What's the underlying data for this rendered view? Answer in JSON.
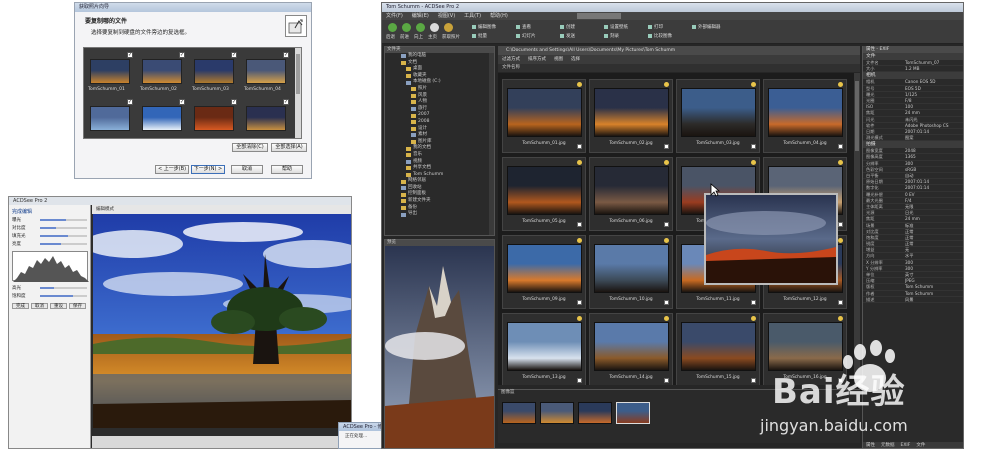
{
  "colors": {
    "main_bg": "#262626",
    "accent_blue": "#0d3a8a",
    "badge_gold": "#e8c44a",
    "dialog_bg": "#f4f4f6"
  },
  "import_dialog": {
    "title": "获取照片向导",
    "heading": "要复制哪的文件",
    "subheading": "选择要复制到硬盘的文件旁边的复选框。",
    "thumb_captions": [
      "TomSchumm_01",
      "TomSchumm_02",
      "TomSchumm_03",
      "TomSchumm_04"
    ],
    "buttons": {
      "deselect_all": "全部清除(C)",
      "select_all": "全部选择(A)",
      "back": "< 上一步(B)",
      "next": "下一步(N) >",
      "cancel": "取消",
      "help": "帮助"
    }
  },
  "editor": {
    "title": "ACDSee Pro 2",
    "side_tab": "完成编辑",
    "topbar_text": "编辑模式",
    "sliders": [
      {
        "label": "曝光",
        "value": 0.55
      },
      {
        "label": "对比度",
        "value": 0.35
      },
      {
        "label": "填充光",
        "value": 0.6
      },
      {
        "label": "亮度",
        "value": 0.45
      },
      {
        "label": "高光",
        "value": 0.3
      },
      {
        "label": "饱和度",
        "value": 0.7
      }
    ],
    "buttons": [
      "完成",
      "取消",
      "重设",
      "保存"
    ]
  },
  "small_dialog": {
    "title": "ACDSee Pro - 修改数据库",
    "left_text": "正在处理...",
    "right_text": "已完成"
  },
  "main": {
    "title": "Tom Schumm - ACDSee Pro 2",
    "menus": [
      "文件(F)",
      "编辑(E)",
      "视图(V)",
      "工具(T)",
      "帮助(H)"
    ],
    "nav_buttons": [
      {
        "label": "后退",
        "color": "#5aa843"
      },
      {
        "label": "前进",
        "color": "#5aa843"
      },
      {
        "label": "向上",
        "color": "#5aa843"
      },
      {
        "label": "主页",
        "color": "#d9d9d9"
      },
      {
        "label": "获取照片",
        "color": "#c9a23a"
      }
    ],
    "tool_items": [
      "编辑图像",
      "批量",
      "查看",
      "幻灯片",
      "创建",
      "发送",
      "设置壁纸",
      "刻录",
      "打印",
      "比较图像",
      "外部编辑器"
    ],
    "tree": {
      "header": "文件夹",
      "items": [
        "我的电脑",
        "文档",
        "桌面",
        "收藏夹",
        "本地磁盘 (C:)",
        "照片",
        "风景",
        "人物",
        "旅行",
        "2007",
        "2008",
        "设计",
        "素材",
        "图片库",
        "我的文档",
        "音乐",
        "视频",
        "共享文档",
        "Tom Schumm",
        "网络邻居",
        "回收站",
        "控制面板",
        "新建文件夹",
        "备份",
        "导出"
      ]
    },
    "preview_header": "预览",
    "folder_path": "C:\\Documents and Settings\\All Users\\Documents\\My Pictures\\Tom Schumm",
    "filter_bar": [
      "过滤方式",
      "排序方式",
      "视图",
      "选择"
    ],
    "sort_label": "文件名称",
    "thumbnails": [
      "TomSchumm_01.jpg",
      "TomSchumm_02.jpg",
      "TomSchumm_03.jpg",
      "TomSchumm_04.jpg",
      "TomSchumm_05.jpg",
      "TomSchumm_06.jpg",
      "TomSchumm_07.jpg",
      "TomSchumm_08.jpg",
      "TomSchumm_09.jpg",
      "TomSchumm_10.jpg",
      "TomSchumm_11.jpg",
      "TomSchumm_12.jpg",
      "TomSchumm_13.jpg",
      "TomSchumm_14.jpg",
      "TomSchumm_15.jpg",
      "TomSchumm_16.jpg"
    ],
    "strip_header": "图像篮",
    "props": {
      "header": "属性 - EXIF",
      "sections": [
        {
          "title": "文件",
          "rows": [
            [
              "文件名",
              "TomSchumm_07"
            ],
            [
              "大小",
              "1.2 MB"
            ]
          ]
        },
        {
          "title": "相机",
          "rows": [
            [
              "相机",
              "Canon EOS 5D"
            ],
            [
              "型号",
              "EOS 5D"
            ],
            [
              "曝光",
              "1/125"
            ],
            [
              "光圈",
              "F/8"
            ],
            [
              "ISO",
              "100"
            ],
            [
              "焦距",
              "24 mm"
            ],
            [
              "闪光",
              "未闪光"
            ],
            [
              "软件",
              "Adobe Photoshop CS"
            ],
            [
              "日期",
              "2007:01:14"
            ],
            [
              "测光模式",
              "图案"
            ]
          ]
        },
        {
          "title": "拍摄",
          "rows": [
            [
              "图像宽度",
              "2048"
            ],
            [
              "图像高度",
              "1365"
            ],
            [
              "分辨率",
              "300"
            ],
            [
              "色彩空间",
              "sRGB"
            ],
            [
              "白平衡",
              "自动"
            ],
            [
              "原始日期",
              "2007:01:14"
            ],
            [
              "数字化",
              "2007:01:14"
            ],
            [
              "曝光补偿",
              "0 EV"
            ],
            [
              "最大光圈",
              "F/4"
            ],
            [
              "主体距离",
              "无限"
            ],
            [
              "光源",
              "日光"
            ],
            [
              "焦距",
              "24 mm"
            ],
            [
              "场景",
              "标准"
            ],
            [
              "对比度",
              "正常"
            ],
            [
              "饱和度",
              "正常"
            ],
            [
              "锐度",
              "正常"
            ],
            [
              "增益",
              "无"
            ],
            [
              "方向",
              "水平"
            ],
            [
              "X 分辨率",
              "300"
            ],
            [
              "Y 分辨率",
              "300"
            ],
            [
              "单位",
              "英寸"
            ],
            [
              "压缩",
              "JPEG"
            ],
            [
              "版权",
              "Tom Schumm"
            ],
            [
              "作者",
              "Tom Schumm"
            ],
            [
              "描述",
              "风景"
            ]
          ]
        }
      ],
      "tabs": [
        "属性",
        "元数据",
        "EXIF",
        "文件"
      ]
    }
  },
  "watermark": {
    "brand": "Bai经验",
    "url": "jingyan.baidu.com"
  }
}
